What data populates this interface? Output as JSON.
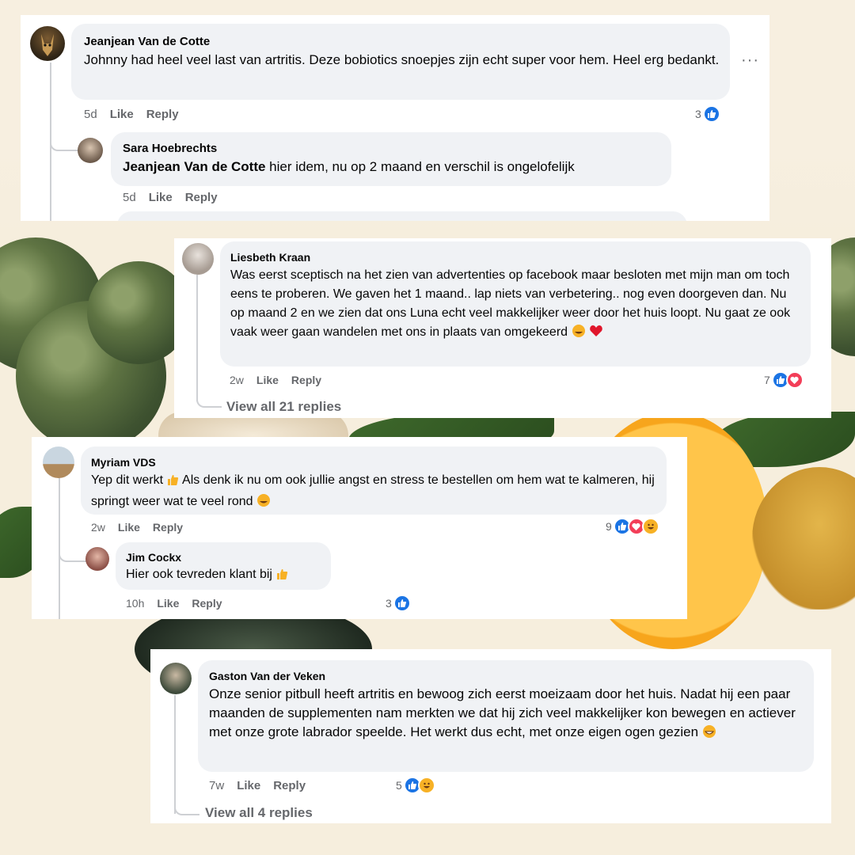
{
  "colors": {
    "like": "#1b74e4",
    "love": "#f33e58",
    "haha": "#f7b125",
    "bubble": "#f0f2f5",
    "meta": "#65676b"
  },
  "card1": {
    "comment": {
      "author": "Jeanjean Van de Cotte",
      "text": "Johnny had heel veel last van artritis. Deze bobiotics snoepjes zijn echt super voor hem. Heel erg bedankt.",
      "time": "5d",
      "like": "Like",
      "reply": "Reply",
      "reaction_count": "3",
      "reactions": [
        "like-icon"
      ]
    },
    "reply": {
      "author": "Sara Hoebrechts",
      "mention": "Jeanjean Van de Cotte",
      "text": " hier idem, nu op 2 maand en verschil is ongelofelijk",
      "time": "5d",
      "like": "Like",
      "reply": "Reply"
    },
    "more_icon": "more-options-icon"
  },
  "card2": {
    "comment": {
      "author": "Liesbeth Kraan",
      "text": "Was eerst sceptisch na het zien van advertenties op facebook maar besloten met mijn man om toch eens te proberen. We gaven het 1 maand.. lap niets van verbetering.. nog even doorgeven dan. Nu op maand 2 en we zien dat ons Luna echt veel makkelijker weer door het huis loopt. Nu gaat ze ook vaak weer gaan wandelen met ons in plaats van omgekeerd",
      "time": "2w",
      "like": "Like",
      "reply": "Reply",
      "reaction_count": "7",
      "reactions": [
        "like-icon",
        "love-icon"
      ]
    },
    "view_all": "View all 21 replies"
  },
  "card3": {
    "comment": {
      "author": "Myriam VDS",
      "text_a": "Yep dit werkt",
      "text_b": " Als denk ik nu om ook jullie angst en stress te bestellen om hem wat te kalmeren, hij springt weer wat te veel rond",
      "time": "2w",
      "like": "Like",
      "reply": "Reply",
      "reaction_count": "9",
      "reactions": [
        "like-icon",
        "love-icon",
        "haha-icon"
      ]
    },
    "reply": {
      "author": "Jim Cockx",
      "text": "Hier ook tevreden klant bij",
      "time": "10h",
      "like": "Like",
      "reply": "Reply",
      "reaction_count": "3",
      "reactions": [
        "like-icon"
      ]
    }
  },
  "card4": {
    "comment": {
      "author": "Gaston Van der Veken",
      "text": "Onze senior pitbull heeft artritis en bewoog zich eerst moeizaam door het huis. Nadat hij een paar maanden de supplementen nam merkten we dat hij zich veel makkelijker kon bewegen en actiever met onze grote labrador speelde. Het werkt dus echt, met onze eigen ogen gezien",
      "time": "7w",
      "like": "Like",
      "reply": "Reply",
      "reaction_count": "5",
      "reactions": [
        "like-icon",
        "haha-icon"
      ]
    },
    "view_all": "View all 4 replies"
  }
}
